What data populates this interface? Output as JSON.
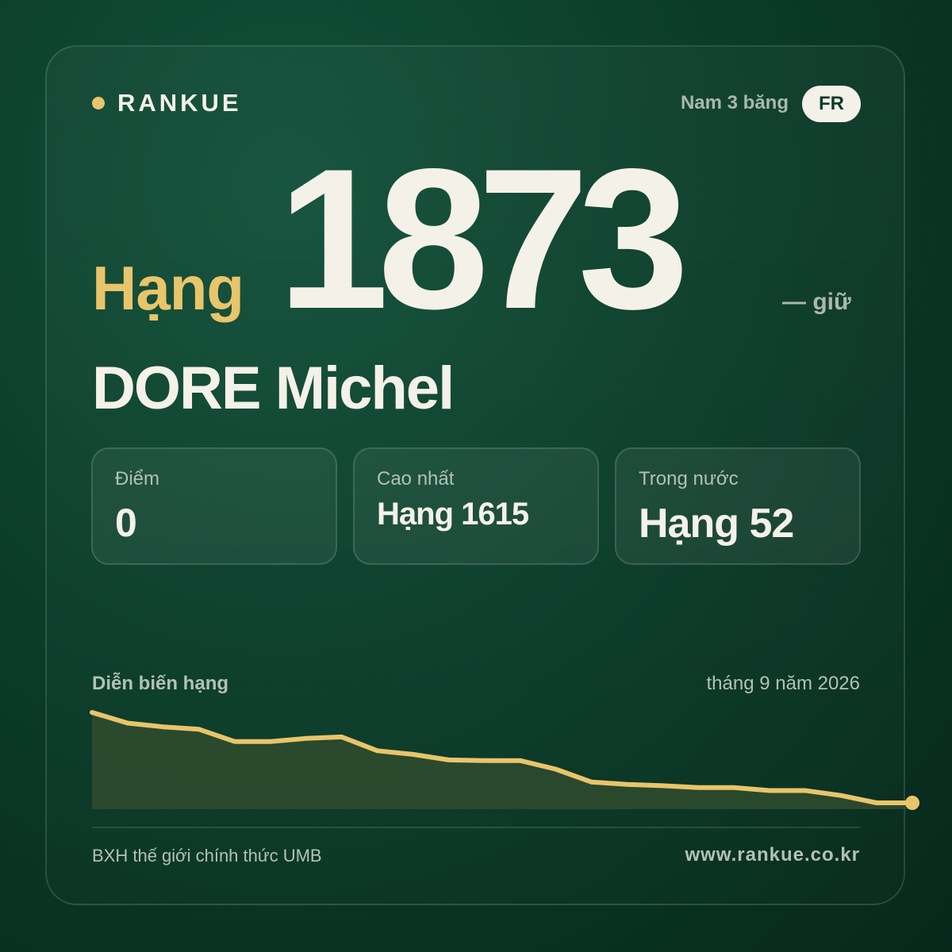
{
  "brand": {
    "name": "RANKUE",
    "accent": "#e8c56a"
  },
  "header": {
    "category": "Nam 3 băng",
    "country": "FR"
  },
  "rank": {
    "prefix": "Hạng",
    "number": "1873",
    "change": "— giữ"
  },
  "player": {
    "name": "DORE Michel"
  },
  "stats": [
    {
      "label": "Điểm",
      "value": "0"
    },
    {
      "label": "Cao nhất",
      "value": "Hạng 1615"
    },
    {
      "label": "Trong nước",
      "value": "Hạng 52"
    }
  ],
  "chart": {
    "title": "Diễn biến hạng",
    "date": "tháng 9 năm 2026"
  },
  "chart_data": {
    "type": "area",
    "title": "Diễn biến hạng",
    "y_inverted": true,
    "series": [
      {
        "values": [
          1615,
          1650,
          1662,
          1670,
          1710,
          1710,
          1700,
          1695,
          1740,
          1752,
          1770,
          1772,
          1772,
          1800,
          1842,
          1850,
          1854,
          1860,
          1860,
          1870,
          1870,
          1886,
          1910,
          1910
        ]
      }
    ],
    "line_color": "#e8c56a",
    "fill_color": "#2e4a2d"
  },
  "footer": {
    "left": "BXH thế giới chính thức UMB",
    "right": "www.rankue.co.kr"
  }
}
